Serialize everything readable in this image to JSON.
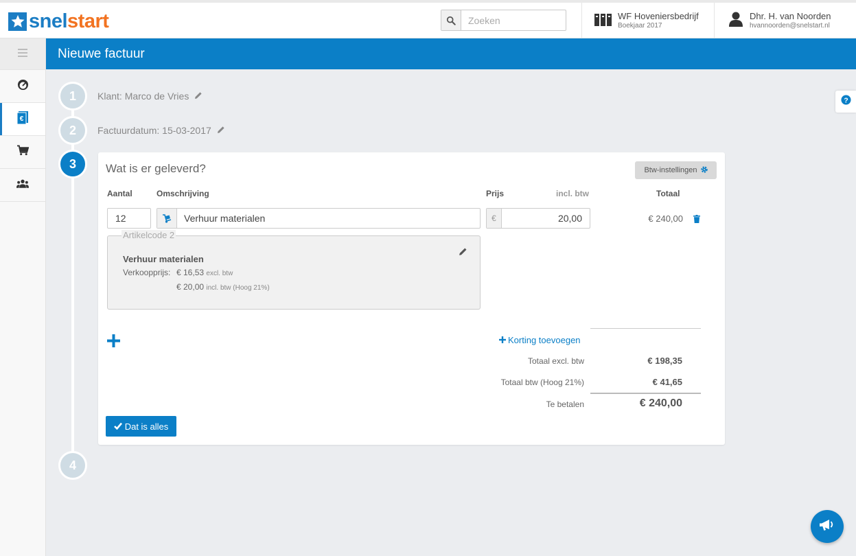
{
  "app": {
    "logo_part1": "snel",
    "logo_part2": "start"
  },
  "search": {
    "placeholder": "Zoeken"
  },
  "company": {
    "name": "WF Hoveniersbedrijf",
    "year": "Boekjaar 2017"
  },
  "user": {
    "name": "Dhr. H. van Noorden",
    "email": "hvannoorden@snelstart.nl"
  },
  "sidebar": {
    "items": [
      {
        "icon": "menu-icon"
      },
      {
        "icon": "dashboard-icon"
      },
      {
        "icon": "invoice-icon",
        "active": true
      },
      {
        "icon": "cart-icon"
      },
      {
        "icon": "people-icon"
      }
    ]
  },
  "page": {
    "title": "Nieuwe factuur"
  },
  "steps": [
    {
      "number": "1",
      "label": "Klant: Marco de Vries"
    },
    {
      "number": "2",
      "label": "Factuurdatum: 15-03-2017"
    },
    {
      "number": "3",
      "label": "Wat is er geleverd?"
    },
    {
      "number": "4",
      "label": ""
    }
  ],
  "card": {
    "btw_button": "Btw-instellingen",
    "headers": {
      "aantal": "Aantal",
      "omschrijving": "Omschrijving",
      "prijs": "Prijs",
      "incl": "incl. btw",
      "totaal": "Totaal"
    },
    "line": {
      "aantal": "12",
      "omschrijving": "Verhuur materialen",
      "currency": "€",
      "prijs": "20,00",
      "totaal": "€ 240,00"
    },
    "article": {
      "legend": "Artikelcode 2",
      "name": "Verhuur materialen",
      "price_label": "Verkoopprijs:",
      "excl_value": "€ 16,53",
      "excl_note": "excl. btw",
      "incl_value": "€ 20,00",
      "incl_note": "incl. btw (Hoog 21%)"
    },
    "discount_link": "Korting toevoegen",
    "summary": {
      "excl_label": "Totaal excl. btw",
      "excl_value": "€ 198,35",
      "btw_label": "Totaal btw (Hoog 21%)",
      "btw_value": "€ 41,65",
      "pay_label": "Te betalen",
      "pay_value": "€ 240,00"
    },
    "done_button": "Dat is alles"
  },
  "colors": {
    "brand_blue": "#0b7fc7",
    "brand_orange": "#f27321"
  }
}
